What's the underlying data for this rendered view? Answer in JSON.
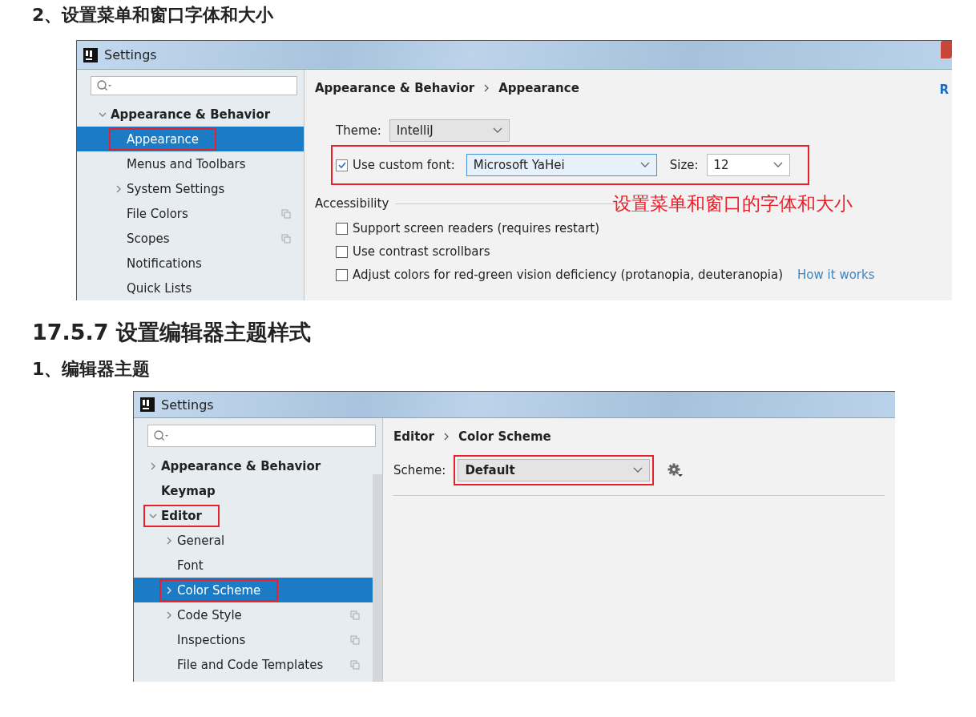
{
  "heading_1": "2、设置菜单和窗口字体和大小",
  "screenshot_1": {
    "title": "Settings",
    "tree": [
      {
        "label": "Appearance & Behavior",
        "expanded": true,
        "selected": false,
        "highlighted": false,
        "shared": false,
        "children": [
          {
            "label": "Appearance",
            "selected": true,
            "highlighted": true,
            "shared": false
          },
          {
            "label": "Menus and Toolbars",
            "selected": false,
            "highlighted": false,
            "shared": false
          },
          {
            "label": "System Settings",
            "expanded": false,
            "selected": false,
            "highlighted": false,
            "shared": false
          },
          {
            "label": "File Colors",
            "selected": false,
            "highlighted": false,
            "shared": true
          },
          {
            "label": "Scopes",
            "selected": false,
            "highlighted": false,
            "shared": true
          },
          {
            "label": "Notifications",
            "selected": false,
            "highlighted": false,
            "shared": false
          },
          {
            "label": "Quick Lists",
            "selected": false,
            "highlighted": false,
            "shared": false
          }
        ]
      }
    ],
    "breadcrumb": [
      "Appearance & Behavior",
      "Appearance"
    ],
    "corner_link": "R",
    "theme": {
      "label": "Theme:",
      "value": "IntelliJ"
    },
    "custom_font": {
      "label": "Use custom font:",
      "checked": true,
      "font": "Microsoft YaHei",
      "size_label": "Size:",
      "size": "12"
    },
    "annotation": "设置菜单和窗口的字体和大小",
    "section": "Accessibility",
    "options": [
      {
        "label": "Support screen readers (requires restart)",
        "checked": false
      },
      {
        "label": "Use contrast scrollbars",
        "checked": false
      },
      {
        "label": "Adjust colors for red-green vision deficiency (protanopia, deuteranopia)",
        "checked": false,
        "link": "How it works"
      }
    ]
  },
  "heading_2": "17.5.7 设置编辑器主题样式",
  "heading_3": "1、编辑器主题",
  "screenshot_2": {
    "title": "Settings",
    "tree": [
      {
        "label": "Appearance & Behavior",
        "expanded": false,
        "selected": false,
        "highlighted": false,
        "shared": false
      },
      {
        "label": "Keymap",
        "selected": false,
        "highlighted": false,
        "shared": false
      },
      {
        "label": "Editor",
        "expanded": true,
        "selected": false,
        "highlighted": true,
        "shared": false,
        "children": [
          {
            "label": "General",
            "expanded": false,
            "selected": false,
            "highlighted": false,
            "shared": false
          },
          {
            "label": "Font",
            "selected": false,
            "highlighted": false,
            "shared": false
          },
          {
            "label": "Color Scheme",
            "expanded": false,
            "selected": true,
            "highlighted": true,
            "shared": false
          },
          {
            "label": "Code Style",
            "expanded": false,
            "selected": false,
            "highlighted": false,
            "shared": true
          },
          {
            "label": "Inspections",
            "selected": false,
            "highlighted": false,
            "shared": true
          },
          {
            "label": "File and Code Templates",
            "selected": false,
            "highlighted": false,
            "shared": true
          }
        ]
      }
    ],
    "breadcrumb": [
      "Editor",
      "Color Scheme"
    ],
    "scheme": {
      "label": "Scheme:",
      "value": "Default",
      "highlighted": true
    }
  }
}
